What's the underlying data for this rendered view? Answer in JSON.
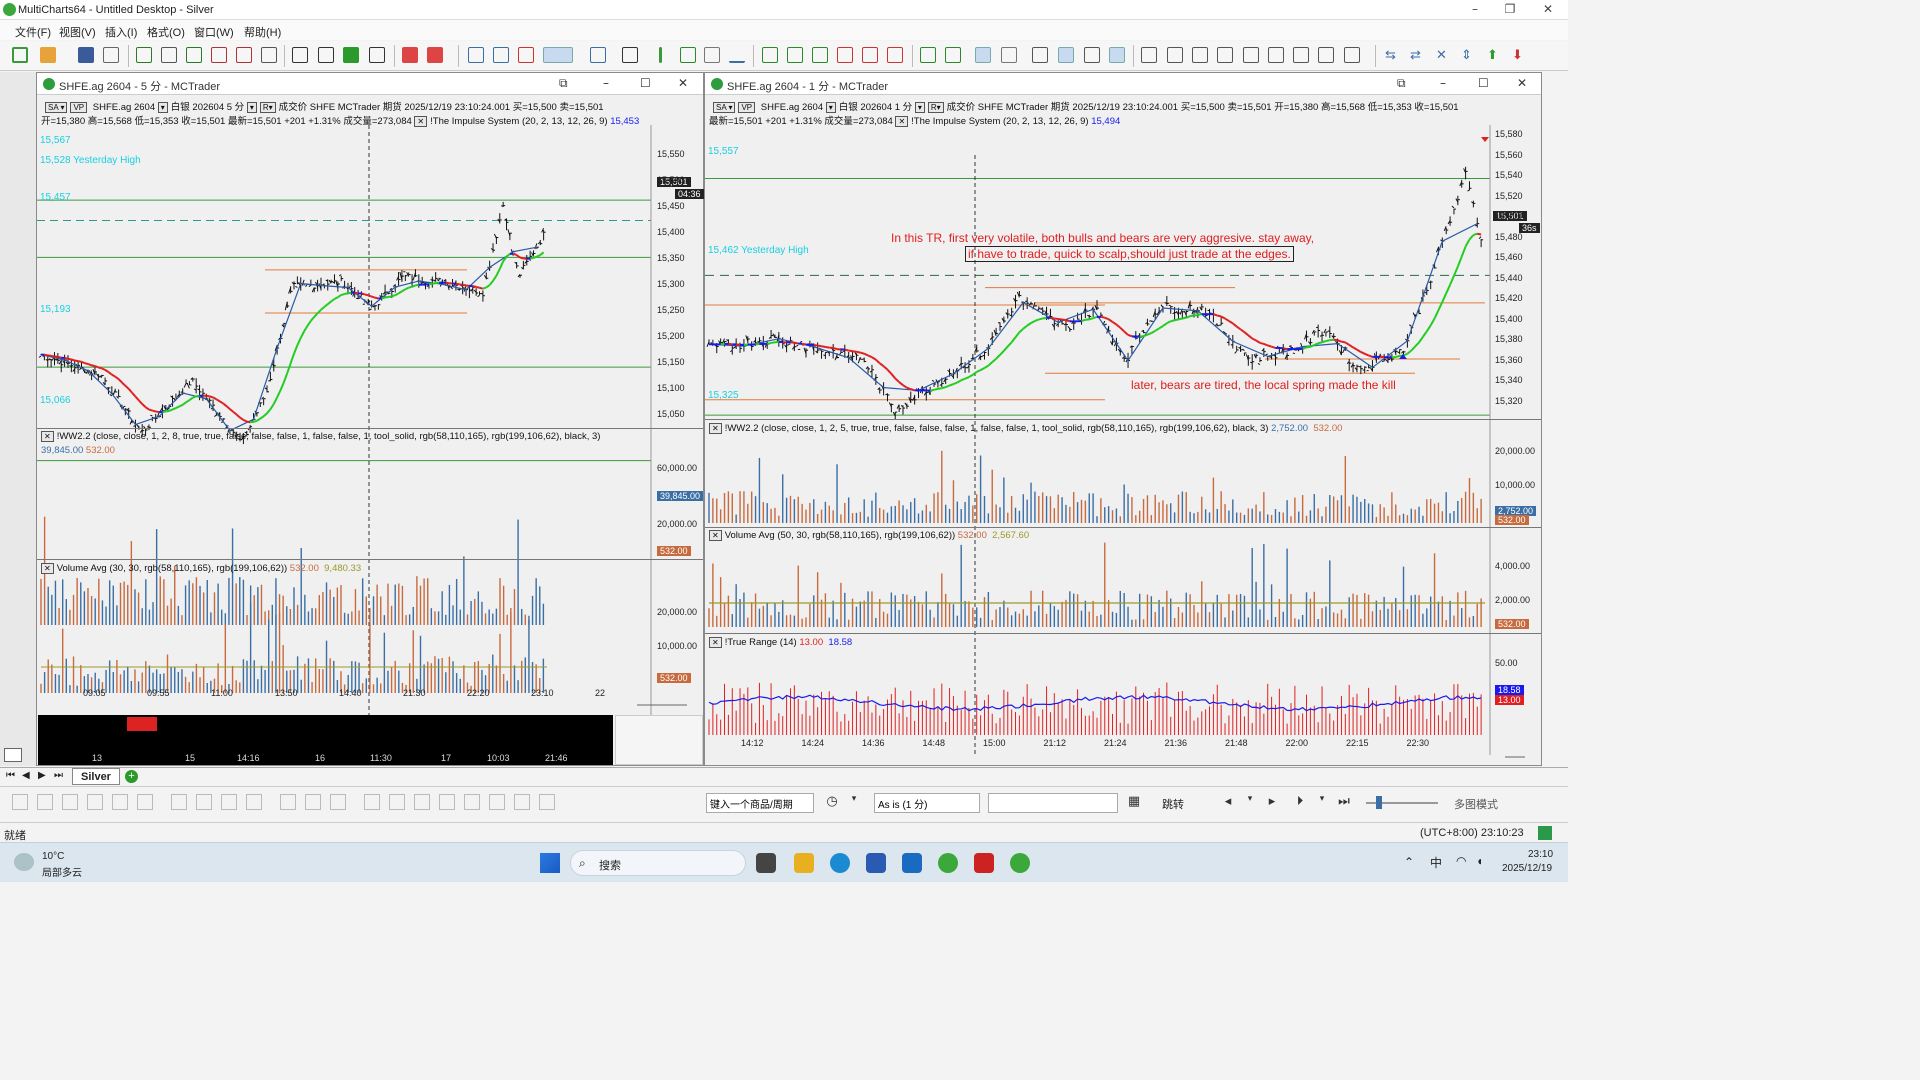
{
  "app": {
    "title": "MultiCharts64 - Untitled Desktop - Silver"
  },
  "menu": [
    "文件(F)",
    "视图(V)",
    "插入(I)",
    "格式(O)",
    "窗口(W)",
    "帮助(H)"
  ],
  "left": {
    "title": "SHFE.ag 2604 - 5 分 - MCTrader",
    "info1_symbol": "SHFE.ag 2604",
    "info1_period": "白银 202604 5 分",
    "info1_rest": "成交价  SHFE  MCTrader  期货  2025/12/19  23:10:24.001  买=15,500  卖=15,501",
    "info2": "开=15,380  高=15,568  低=15,353  收=15,501  最新=15,501  +201  +1.31%  成交量=273,084",
    "info2_study": "!The Impulse System   (20, 2, 13, 12, 26, 9)",
    "info2_val": "15,453",
    "levels": {
      "l1": "15,567",
      "l2": "15,528 Yesterday High",
      "l3": "15,457",
      "l4": "15,193",
      "l5": "15,066"
    },
    "price_axis": [
      "15,550",
      "15,500",
      "15,450",
      "15,400",
      "15,350",
      "15,300",
      "15,250",
      "15,200",
      "15,150",
      "15,100",
      "15,050"
    ],
    "last_price": "15,501",
    "last_timer": "04:36",
    "ww_title": "!WW2.2   (close,  close,  1,  2,  8,  true,  true,  false,  false,  false,  1,  false,  false,  1,  tool_solid,  rgb(58,110,165),  rgb(199,106,62),  black,  3)",
    "ww_v1": "39,845.00",
    "ww_v2": "532.00",
    "ww_axis": [
      "60,000.00",
      "40,000.00",
      "20,000.00"
    ],
    "ww_tag": "39,845.00",
    "ww_tag2": "532.00",
    "va_title": "Volume Avg   (30,  30,  rgb(58,110,165),  rgb(199,106,62))",
    "va_v1": "532.00",
    "va_v2": "9,480.33",
    "va_axis": [
      "20,000.00",
      "10,000.00"
    ],
    "va_tag": "532.00",
    "time_axis": [
      "09:05",
      "09:55",
      "11:00",
      "13:50",
      "14:40",
      "21:30",
      "22:20",
      "23:10",
      "22"
    ],
    "nav_axis": [
      "13",
      "15",
      "14:16",
      "16",
      "11:30",
      "17",
      "10:03",
      "21:46"
    ]
  },
  "right": {
    "title": "SHFE.ag 2604 - 1 分 - MCTrader",
    "info1_symbol": "SHFE.ag 2604",
    "info1_period": "白银 202604 1 分",
    "info1_rest": "成交价  SHFE  MCTrader  期货  2025/12/19  23:10:24.001  买=15,500  卖=15,501  开=15,380  高=15,568  低=15,353  收=15,501",
    "info2": "最新=15,501  +201    +1.31%  成交量=273,084",
    "info2_study": "!The Impulse System   (20, 2, 13, 12, 26, 9)",
    "info2_val": "15,494",
    "levels": {
      "l1": "15,557",
      "l2": "15,462 Yesterday High",
      "l3": "15,325"
    },
    "anno1": "In this TR, first very volatile, both bulls and bears are very aggresive. stay away,",
    "anno2": "if have to trade, quick to scalp,should just trade at the edges.",
    "anno3": "later, bears are tired, the local spring made the kill",
    "price_axis": [
      "15,580",
      "15,560",
      "15,540",
      "15,520",
      "15,500",
      "15,480",
      "15,460",
      "15,440",
      "15,420",
      "15,400",
      "15,380",
      "15,360",
      "15,340",
      "15,320"
    ],
    "last_price": "15,501",
    "last_timer": "36s",
    "ww_title": "!WW2.2   (close,  close,  1,  2,  5,  true,  true,  false,  false,  false,  1,  false,  false,  1,  tool_solid,  rgb(58,110,165),  rgb(199,106,62),  black,  3)",
    "ww_v1": "2,752.00",
    "ww_v2": "532.00",
    "ww_axis": [
      "20,000.00",
      "10,000.00"
    ],
    "ww_tag": "2,752.00",
    "ww_tag2": "532.00",
    "va_title": "Volume Avg   (50,  30,  rgb(58,110,165),  rgb(199,106,62))",
    "va_v1": "532.00",
    "va_v2": "2,567.60",
    "va_axis": [
      "4,000.00",
      "2,000.00"
    ],
    "va_tag": "532.00",
    "tr_title": "!True Range   (14)",
    "tr_v1": "13.00",
    "tr_v2": "18.58",
    "tr_axis": [
      "50.00"
    ],
    "tr_tag1": "18.58",
    "tr_tag2": "13.00",
    "time_axis": [
      "14:12",
      "14:24",
      "14:36",
      "14:48",
      "15:00",
      "21:12",
      "21:24",
      "21:36",
      "21:48",
      "22:00",
      "22:15",
      "22:30"
    ]
  },
  "sheet_tab": "Silver",
  "drawbar": {
    "symbol_input": "键入一个商品/周期",
    "resolution": "As is (1 分)",
    "jump": "跳转",
    "multi": "多图模式"
  },
  "status": {
    "ready": "就绪",
    "clock": "(UTC+8:00) 23:10:23"
  },
  "taskbar": {
    "temp": "10°C",
    "weather": "局部多云",
    "search": "搜索",
    "ime": "中",
    "time": "23:10",
    "date": "2025/12/19"
  },
  "colors": {
    "bull": "#3a6ea5",
    "bear": "#c76a3e",
    "impulse_green": "#22cc22",
    "impulse_red": "#e02020",
    "impulse_blue": "#1a1aee",
    "level_green": "#3a9a3a",
    "annotation": "#e02020"
  }
}
